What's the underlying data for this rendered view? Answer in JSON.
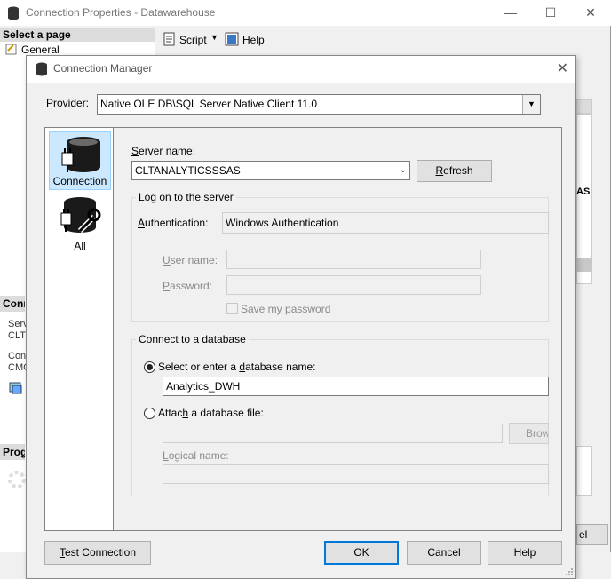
{
  "background_window": {
    "title": "Connection Properties - Datawarehouse",
    "select_page": "Select a page",
    "general": "General",
    "script_label": "Script",
    "help_label": "Help",
    "connection_head": "Conn",
    "server_label": "Serv",
    "server_value": "CLT",
    "connection_label": "Conn",
    "connection_value": "CMC",
    "progress_head": "Prog",
    "cancel_partial": "el",
    "right_partial": "AS"
  },
  "dialog": {
    "title": "Connection Manager",
    "provider_label": "Provider:",
    "provider_value": "Native OLE DB\\SQL Server Native Client 11.0",
    "nav": [
      {
        "label": "Connection",
        "icon": "database-plug-icon",
        "selected": true
      },
      {
        "label": "All",
        "icon": "database-wrench-icon",
        "selected": false
      }
    ],
    "server_name_label": "Server name:",
    "server_name_value": "CLTANALYTICSSSAS",
    "refresh_label": "Refresh",
    "logon_group": "Log on to the server",
    "auth_label": "Authentication:",
    "auth_value": "Windows Authentication",
    "user_name_label": "User name:",
    "password_label": "Password:",
    "save_password_label": "Save my password",
    "database_group": "Connect to a database",
    "select_db_label": "Select or enter a database name:",
    "db_name_value": "Analytics_DWH",
    "attach_label": "Attach a database file:",
    "browse_label": "Brow",
    "logical_name_label": "Logical name:",
    "test_connection_label": "Test Connection",
    "ok_label": "OK",
    "cancel_label": "Cancel",
    "help_label": "Help"
  }
}
